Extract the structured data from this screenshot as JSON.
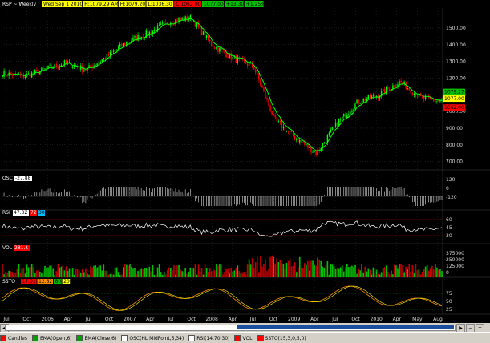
{
  "header": {
    "symbol": "RSP",
    "sep": "~",
    "period": "Weekly",
    "date": "Wed Sep 1 2010",
    "ohlc": [
      "H:1079.29 AM",
      "H:1079.20",
      "L:1036.30",
      "C:1062.00"
    ],
    "last": "1077.00",
    "change": "+13.30",
    "change_pct": "+1.25%"
  },
  "price_axis": {
    "labels": [
      "1500.00",
      "1400.00",
      "1300.00",
      "1200.00",
      "1100.00",
      "1000.00",
      "900.00",
      "800.00",
      "700.00"
    ],
    "values": [
      1500,
      1400,
      1300,
      1200,
      1100,
      1000,
      900,
      800,
      700
    ]
  },
  "price_markers": [
    {
      "text": "1079.27",
      "bg": "#00c000"
    },
    {
      "text": "1077.00",
      "bg": "#ffff00"
    },
    {
      "text": "1062.00",
      "bg": "#ff0000"
    }
  ],
  "osc": {
    "label": "OSC",
    "value": "-27.88",
    "axis": [
      "120",
      "0",
      "-120"
    ]
  },
  "rsi": {
    "label": "RSI",
    "value": "47.32",
    "axis": [
      "60",
      "45",
      "30"
    ],
    "badges": [
      "72",
      "30"
    ]
  },
  "vol": {
    "label": "VOL",
    "value": "281.1",
    "axis": [
      "375000",
      "250000",
      "125000",
      "0"
    ]
  },
  "ssto": {
    "label": "SSTO",
    "values": [
      "17.01",
      "12.62",
      "80",
      "20"
    ],
    "axis": [
      "75",
      "50",
      "25"
    ]
  },
  "x_axis": [
    "Jul",
    "Oct",
    "2006",
    "Apr",
    "Jul",
    "Oct",
    "2007",
    "Apr",
    "Jul",
    "Oct",
    "2008",
    "Apr",
    "Jul",
    "Oct",
    "2009",
    "Apr",
    "Jul",
    "Oct",
    "2010",
    "Apr",
    "May",
    "Aug"
  ],
  "toolbar": [
    {
      "label": "Candles",
      "color": "#ff0000"
    },
    {
      "label": "EMA(Open,6)",
      "color": "#00a000"
    },
    {
      "label": "EMA(Close,6)",
      "color": "#00a000"
    },
    {
      "label": "OSC(HL MidPoint,5,34)",
      "color": "#ffffff"
    },
    {
      "label": "RSI(14,70,30)",
      "color": "#ffffff"
    },
    {
      "label": "VOL",
      "color": "#ff0000"
    },
    {
      "label": "SSTO(15,3,0,5,0)",
      "color": "#ff0000"
    }
  ],
  "colors": {
    "up": "#00ff00",
    "down": "#ff0000",
    "ema": "#00ff00",
    "grid": "#333333",
    "ssto1": "#ff8c00",
    "ssto2": "#ffff00"
  },
  "chart_data": {
    "type": "line",
    "title": "RSP ~ Weekly",
    "x": [
      "Jul 2005",
      "Oct 2005",
      "2006",
      "Apr 2006",
      "Jul 2006",
      "Oct 2006",
      "2007",
      "Apr 2007",
      "Jul 2007",
      "Oct 2007",
      "2008",
      "Apr 2008",
      "Jul 2008",
      "Oct 2008",
      "2009",
      "Apr 2009",
      "Jul 2009",
      "Oct 2009",
      "2010",
      "Apr 2010",
      "May 2010",
      "Aug 2010"
    ],
    "series": [
      {
        "values": [
          1230,
          1210,
          1250,
          1290,
          1250,
          1330,
          1420,
          1470,
          1540,
          1560,
          1400,
          1320,
          1270,
          950,
          840,
          750,
          930,
          1060,
          1100,
          1180,
          1080,
          1060
        ]
      }
    ],
    "ylim": [
      650,
      1620
    ],
    "xlabel": "",
    "ylabel": ""
  }
}
